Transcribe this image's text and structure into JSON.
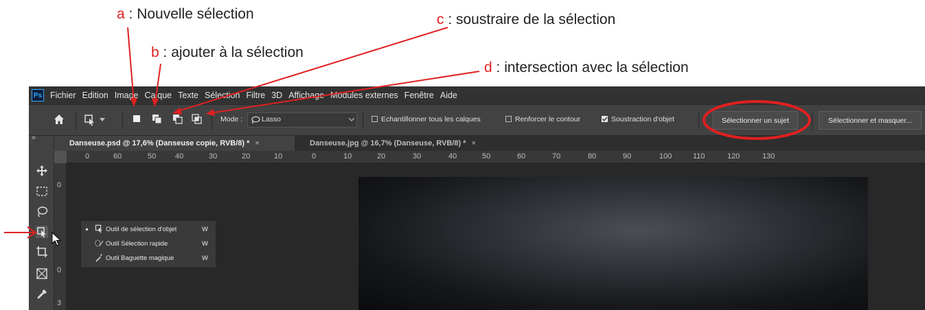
{
  "annotations": [
    {
      "key": "a",
      "text": " : Nouvelle sélection"
    },
    {
      "key": "b",
      "text": " : ajouter à la sélection"
    },
    {
      "key": "c",
      "text": " : soustraire de la sélection"
    },
    {
      "key": "d",
      "text": " : intersection avec la sélection"
    }
  ],
  "annotation_color": "#e02020",
  "menubar": {
    "logo": "Ps",
    "items": [
      "Fichier",
      "Edition",
      "Image",
      "Calque",
      "Texte",
      "Sélection",
      "Filtre",
      "3D",
      "Affichage",
      "Modules externes",
      "Fenêtre",
      "Aide"
    ]
  },
  "options": {
    "mode_label": "Mode :",
    "mode_value": "Lasso",
    "sample_all_layers": {
      "label": "Echantillonner tous les calques",
      "checked": false
    },
    "enhance_edge": {
      "label": "Renforcer le contour",
      "checked": false
    },
    "object_subtract": {
      "label": "Soustraction d'objet",
      "checked": true
    },
    "select_subject_button": "Sélectionner un sujet",
    "select_mask_button": "Sélectionner et masquer..."
  },
  "tabs": [
    {
      "label": "Danseuse.psd @ 17,6% (Danseuse copie, RVB/8) *",
      "close": "×",
      "active": true
    },
    {
      "label": "Danseuse.jpg @ 16,7% (Danseuse, RVB/8) *",
      "close": "×",
      "active": false
    }
  ],
  "ruler_h": [
    "0",
    "60",
    "50",
    "40",
    "30",
    "20",
    "10",
    "0",
    "10",
    "20",
    "30",
    "40",
    "50",
    "60",
    "70",
    "80",
    "90",
    "100",
    "110",
    "120",
    "130"
  ],
  "ruler_v": [
    "0",
    "0",
    "3"
  ],
  "flyout": [
    {
      "label": "Outil de sélection d'objet",
      "key": "W",
      "selected": true
    },
    {
      "label": "Outil Sélection rapide",
      "key": "W",
      "selected": false
    },
    {
      "label": "Outil Baguette magique",
      "key": "W",
      "selected": false
    }
  ],
  "collapse_arrows": "»"
}
